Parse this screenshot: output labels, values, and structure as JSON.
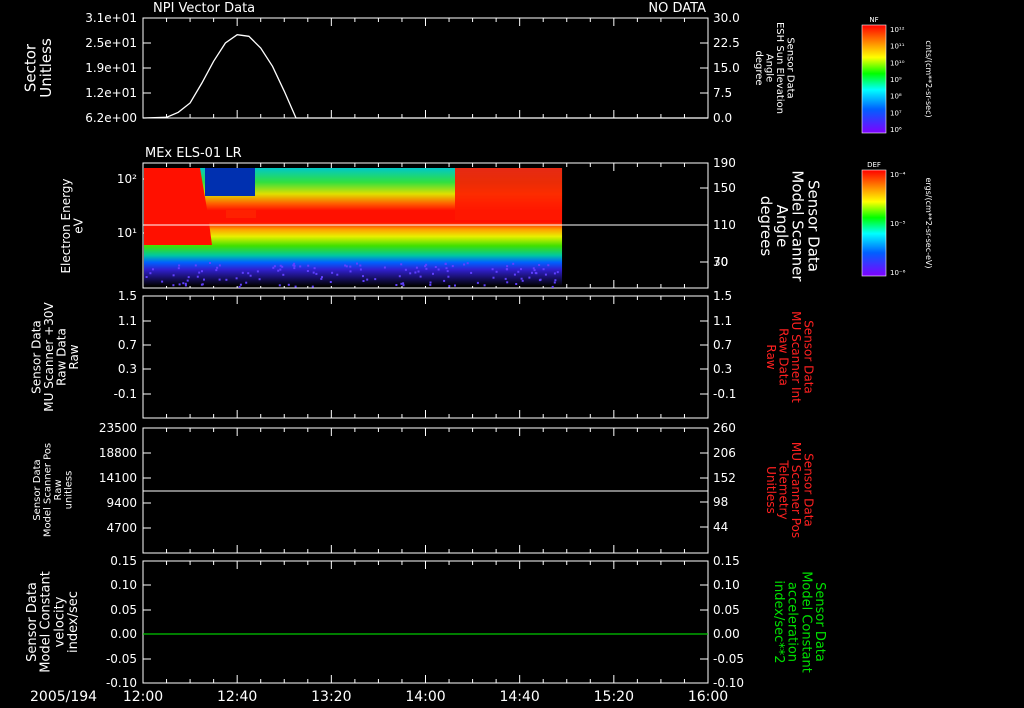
{
  "chart_data": [
    {
      "type": "line",
      "title": "NPI Vector Data",
      "status": "NO DATA",
      "ylabel_left": [
        "Sector",
        "Unitless"
      ],
      "ylabel_right": [
        "Sensor Data",
        "ESH Sun Elevation",
        "Angle",
        "degree"
      ],
      "left_ticks": [
        "3.1e+01",
        "2.5e+01",
        "1.9e+01",
        "1.2e+01",
        "6.2e+00"
      ],
      "right_ticks": [
        "30.0",
        "22.5",
        "15.0",
        "7.5",
        "0.0"
      ],
      "ylim_right": [
        -3,
        30
      ],
      "series": [
        {
          "x": [
            "12:00",
            "12:10",
            "12:15",
            "12:20",
            "12:25",
            "12:30",
            "12:35",
            "12:40",
            "12:45",
            "12:50",
            "12:55",
            "13:00",
            "13:05",
            "13:10",
            "13:20",
            "14:00",
            "15:00",
            "16:00"
          ],
          "y": [
            0,
            0.2,
            1.7,
            4.5,
            10.5,
            17,
            22.5,
            25,
            24.5,
            21,
            15.5,
            8,
            0,
            0,
            0,
            0,
            0,
            0
          ],
          "color": "#ffffff"
        }
      ]
    },
    {
      "type": "heatmap",
      "title": "MEx ELS-01 LR",
      "ylabel_left": [
        "Electron Energy",
        "eV"
      ],
      "ylabel_right": [
        "Sensor Data",
        "Model Scanner",
        "Angle",
        "degrees"
      ],
      "left_ticks": [
        "10²",
        "10¹"
      ],
      "right_ticks": [
        "190",
        "150",
        "110",
        "70",
        "30"
      ],
      "data_end": "14:58",
      "line_value": 95,
      "colorbar": {
        "label": "DEF",
        "unit": "ergs/(cm**2-sr-sec-eV)",
        "ticks": [
          "10⁻⁴",
          "10⁻⁵",
          "10⁻⁶"
        ]
      }
    },
    {
      "type": "line",
      "ylabel_left": [
        "Sensor Data",
        "MU Scanner +30V",
        "Raw Data",
        "Raw"
      ],
      "ylabel_right": [
        "Sensor Data",
        "MU Scanner Int",
        "Raw Data",
        "Raw"
      ],
      "left_ticks": [
        "1.5",
        "1.1",
        "0.7",
        "0.3",
        "-0.1"
      ],
      "right_ticks": [
        "1.5",
        "1.1",
        "0.7",
        "0.3",
        "-0.1"
      ],
      "series": []
    },
    {
      "type": "line",
      "ylabel_left": [
        "Sensor Data",
        "Model Scanner Pos",
        "Raw",
        "unitless"
      ],
      "ylabel_right": [
        "Sensor Data",
        "MU Scanner Pos",
        "Telemetry",
        "Unitless"
      ],
      "left_ticks": [
        "23500",
        "18800",
        "14100",
        "9400",
        "4700"
      ],
      "right_ticks": [
        "260",
        "206",
        "152",
        "98",
        "44"
      ],
      "series": [
        {
          "x": [
            "12:00",
            "16:00"
          ],
          "y": [
            11000,
            11000
          ],
          "color": "#ffffff"
        }
      ]
    },
    {
      "type": "line",
      "ylabel_left": [
        "Sensor Data",
        "Model Constant",
        "velocity",
        "index/sec"
      ],
      "ylabel_right": [
        "Sensor Data",
        "Model Constant",
        "acceleration",
        "index/sec**2"
      ],
      "left_ticks": [
        "0.15",
        "0.10",
        "0.05",
        "0.00",
        "-0.05",
        "-0.10"
      ],
      "right_ticks": [
        "0.15",
        "0.10",
        "0.05",
        "0.00",
        "-0.05",
        "-0.10"
      ],
      "series": [
        {
          "x": [
            "12:00",
            "16:00"
          ],
          "y": [
            0,
            0
          ],
          "color": "#00c800"
        }
      ]
    }
  ],
  "top_colorbar": {
    "label": "NF",
    "unit": "cnts/(cm**2-sr-sec)",
    "ticks": [
      "10¹²",
      "10¹¹",
      "10¹⁰",
      "10⁹",
      "10⁸",
      "10⁷",
      "10⁶"
    ]
  },
  "x_axis": {
    "date": "2005/194",
    "ticks": [
      "12:00",
      "12:40",
      "13:20",
      "14:00",
      "14:40",
      "15:20",
      "16:00"
    ]
  },
  "colors": {
    "red_label": "#ff2020",
    "green_label": "#00e000",
    "axis": "#ffffff"
  }
}
